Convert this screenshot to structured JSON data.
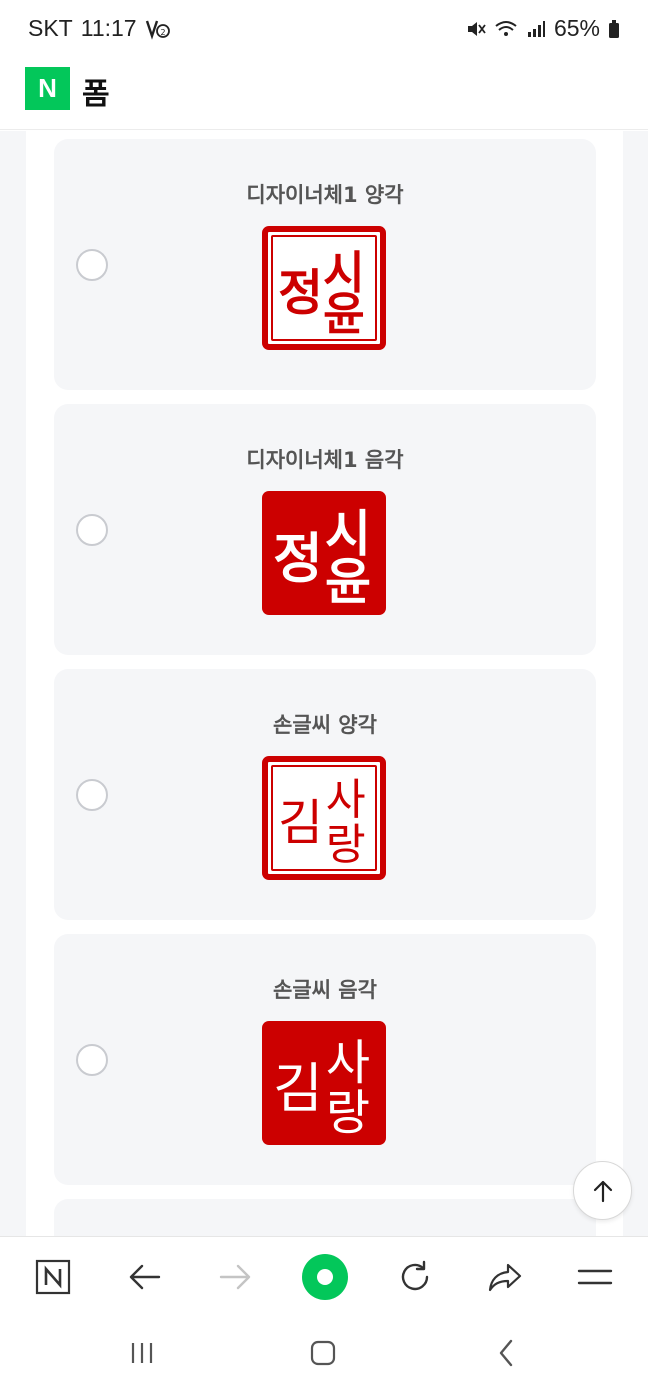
{
  "status_bar": {
    "carrier": "SKT",
    "time": "11:17",
    "battery": "65%"
  },
  "header": {
    "logo": "N",
    "title": "폼"
  },
  "options": [
    {
      "label": "디자이너체1 양각",
      "seal_text": [
        "정",
        "시",
        "윤"
      ],
      "style": "yang"
    },
    {
      "label": "디자이너체1 음각",
      "seal_text": [
        "정",
        "시",
        "윤"
      ],
      "style": "eum"
    },
    {
      "label": "손글씨 양각",
      "seal_text": [
        "김",
        "사",
        "랑"
      ],
      "style": "yang"
    },
    {
      "label": "손글씨 음각",
      "seal_text": [
        "김",
        "사",
        "랑"
      ],
      "style": "eum"
    }
  ],
  "colors": {
    "naver_green": "#03c75a",
    "seal_red": "#cc0000",
    "card_background": "#f5f6f8"
  },
  "icons": {
    "scroll_top": "arrow-up-icon",
    "browser_bar": [
      "naver-n-icon",
      "back-arrow-icon",
      "forward-arrow-icon",
      "home-icon",
      "refresh-icon",
      "share-icon",
      "menu-icon"
    ],
    "system_nav": [
      "recent-apps-icon",
      "home-icon",
      "back-icon"
    ]
  }
}
